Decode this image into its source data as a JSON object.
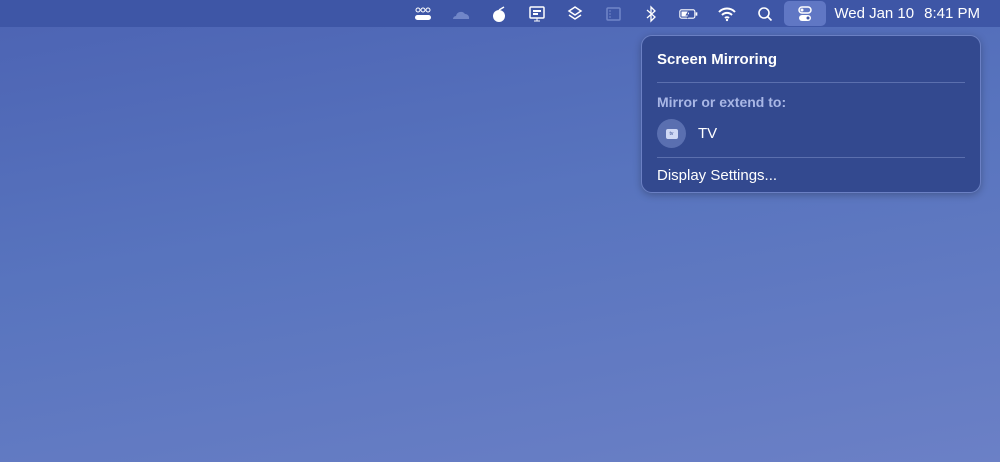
{
  "menubar": {
    "icons": [
      "toggle-switches-icon",
      "cloud-icon",
      "apple-fruit-icon",
      "monitor-icon",
      "layers-icon",
      "sidebar-icon",
      "bluetooth-icon",
      "battery-charging-icon",
      "wifi-icon",
      "search-icon",
      "control-center-icon"
    ],
    "date": "Wed Jan 10",
    "time": "8:41 PM"
  },
  "popup": {
    "title": "Screen Mirroring",
    "section": "Mirror or extend to:",
    "device": {
      "name": "TV",
      "icon": "apple-tv-icon",
      "icon_text": "tv"
    },
    "settings": "Display Settings..."
  }
}
